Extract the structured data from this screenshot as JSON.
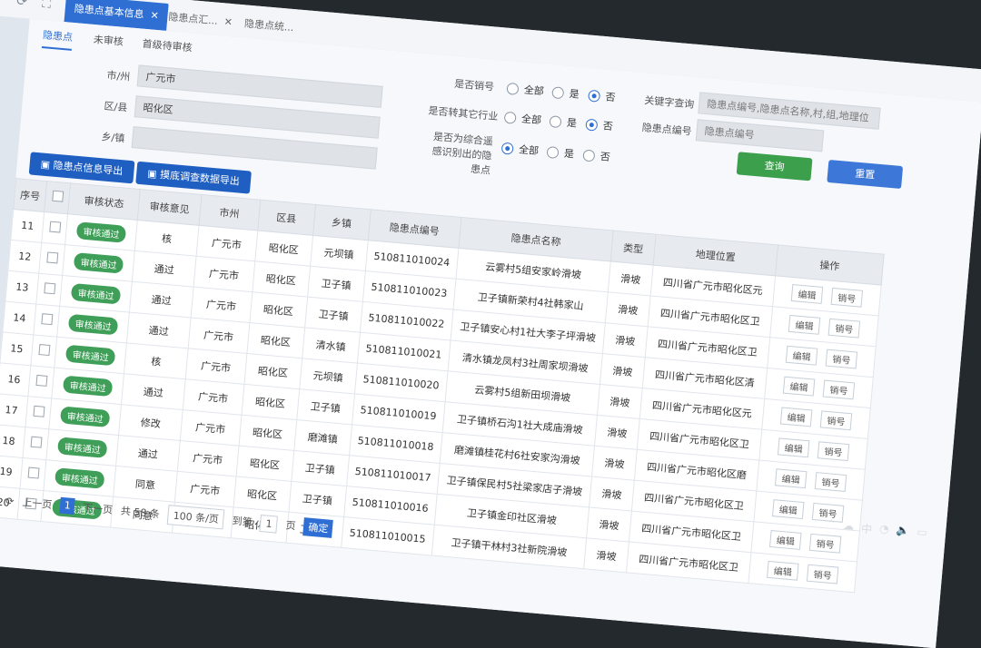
{
  "tabs": [
    "隐患点基本信息",
    "隐患点汇...",
    "隐患点统..."
  ],
  "subtabs": [
    "隐患点",
    "未审核",
    "首级待审核"
  ],
  "filters": {
    "city_label": "市/州",
    "city_value": "广元市",
    "district_label": "区/县",
    "district_value": "昭化区",
    "town_label": "乡/镇",
    "town_value": "",
    "q1": "是否销号",
    "q2": "是否转其它行业",
    "q3": "是否为综合遥感识别出的隐患点",
    "opt_all": "全部",
    "opt_yes": "是",
    "opt_no": "否",
    "keyword_label": "关键字查询",
    "keyword_placeholder": "隐患点编号,隐患点名称,村,组,地理位置",
    "code_label": "隐患点编号",
    "code_placeholder": "隐患点编号",
    "query_btn": "查询",
    "reset_btn": "重置"
  },
  "actions": [
    "隐患点信息导出",
    "摸底调查数据导出"
  ],
  "headers": [
    "序号",
    "",
    "审核状态",
    "审核意见",
    "市州",
    "区县",
    "乡镇",
    "隐患点编号",
    "隐患点名称",
    "类型",
    "地理位置",
    "操作"
  ],
  "rows": [
    {
      "no": "11",
      "status": "审核通过",
      "opinion": "核",
      "city": "广元市",
      "county": "昭化区",
      "town": "元坝镇",
      "code": "510811010024",
      "name": "云雾村5组安家岭滑坡",
      "type": "滑坡",
      "loc": "四川省广元市昭化区元"
    },
    {
      "no": "12",
      "status": "审核通过",
      "opinion": "通过",
      "city": "广元市",
      "county": "昭化区",
      "town": "卫子镇",
      "code": "510811010023",
      "name": "卫子镇新荣村4社韩家山",
      "type": "滑坡",
      "loc": "四川省广元市昭化区卫"
    },
    {
      "no": "13",
      "status": "审核通过",
      "opinion": "通过",
      "city": "广元市",
      "county": "昭化区",
      "town": "卫子镇",
      "code": "510811010022",
      "name": "卫子镇安心村1社大李子坪滑坡",
      "type": "滑坡",
      "loc": "四川省广元市昭化区卫"
    },
    {
      "no": "14",
      "status": "审核通过",
      "opinion": "通过",
      "city": "广元市",
      "county": "昭化区",
      "town": "清水镇",
      "code": "510811010021",
      "name": "清水镇龙凤村3社周家坝滑坡",
      "type": "滑坡",
      "loc": "四川省广元市昭化区清"
    },
    {
      "no": "15",
      "status": "审核通过",
      "opinion": "核",
      "city": "广元市",
      "county": "昭化区",
      "town": "元坝镇",
      "code": "510811010020",
      "name": "云雾村5组新田坝滑坡",
      "type": "滑坡",
      "loc": "四川省广元市昭化区元"
    },
    {
      "no": "16",
      "status": "审核通过",
      "opinion": "通过",
      "city": "广元市",
      "county": "昭化区",
      "town": "卫子镇",
      "code": "510811010019",
      "name": "卫子镇桥石沟1社大成庙滑坡",
      "type": "滑坡",
      "loc": "四川省广元市昭化区卫"
    },
    {
      "no": "17",
      "status": "审核通过",
      "opinion": "修改",
      "city": "广元市",
      "county": "昭化区",
      "town": "磨滩镇",
      "code": "510811010018",
      "name": "磨滩镇桂花村6社安家沟滑坡",
      "type": "滑坡",
      "loc": "四川省广元市昭化区磨"
    },
    {
      "no": "18",
      "status": "审核通过",
      "opinion": "通过",
      "city": "广元市",
      "county": "昭化区",
      "town": "卫子镇",
      "code": "510811010017",
      "name": "卫子镇保民村5社梁家店子滑坡",
      "type": "滑坡",
      "loc": "四川省广元市昭化区卫"
    },
    {
      "no": "19",
      "status": "审核通过",
      "opinion": "同意",
      "city": "广元市",
      "county": "昭化区",
      "town": "卫子镇",
      "code": "510811010016",
      "name": "卫子镇金印社区滑坡",
      "type": "滑坡",
      "loc": "四川省广元市昭化区卫"
    },
    {
      "no": "20",
      "status": "审核通过",
      "opinion": "同意",
      "city": "广元市",
      "county": "昭化区",
      "town": "卫子镇",
      "code": "510811010015",
      "name": "卫子镇干林村3社新院滑坡",
      "type": "滑坡",
      "loc": "四川省广元市昭化区卫"
    }
  ],
  "op_edit": "编辑",
  "op_cancel": "销号",
  "pager": {
    "prev": "上一页",
    "current": "1",
    "next": "下一页",
    "total": "共 58 条",
    "size": "100 条/页",
    "goto": "到第",
    "page": "1",
    "unit": "页",
    "ok": "确定"
  },
  "tray": [
    "⌃",
    "☁",
    "中",
    "◔",
    "🔈",
    "▭"
  ]
}
